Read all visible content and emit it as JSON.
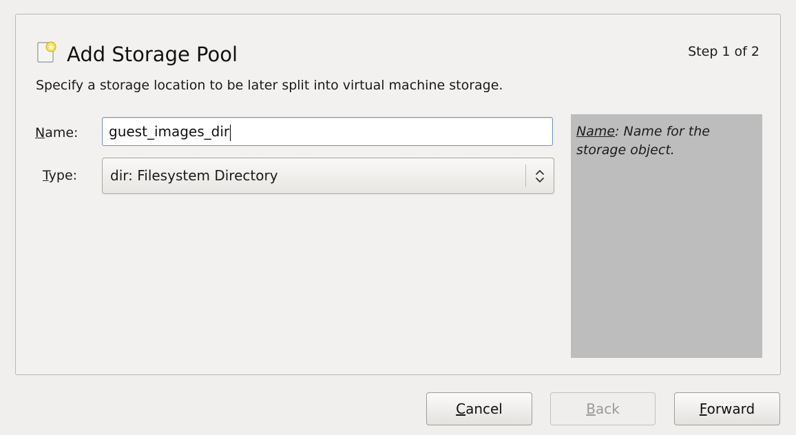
{
  "header": {
    "title": "Add Storage Pool",
    "step": "Step 1 of 2",
    "subtitle": "Specify a storage location to be later split into virtual machine storage.",
    "icon": "storage-pool-add-icon"
  },
  "form": {
    "name_label_mnemonic": "N",
    "name_label_rest": "ame:",
    "name_value": "guest_images_dir",
    "type_label_mnemonic": "T",
    "type_label_rest": "ype:",
    "type_value": "dir: Filesystem Directory",
    "type_arrows_icon": "updown-chevron-icon"
  },
  "help": {
    "term": "Name",
    "text": ": Name for the storage object."
  },
  "buttons": {
    "cancel_mnemonic": "C",
    "cancel_rest": "ancel",
    "back_mnemonic": "B",
    "back_rest": "ack",
    "forward_mnemonic": "F",
    "forward_rest": "orward"
  },
  "colors": {
    "help_panel_bg": "#bdbdbd",
    "input_focus_border": "#6e8fc1",
    "window_bg": "#f0efed"
  }
}
